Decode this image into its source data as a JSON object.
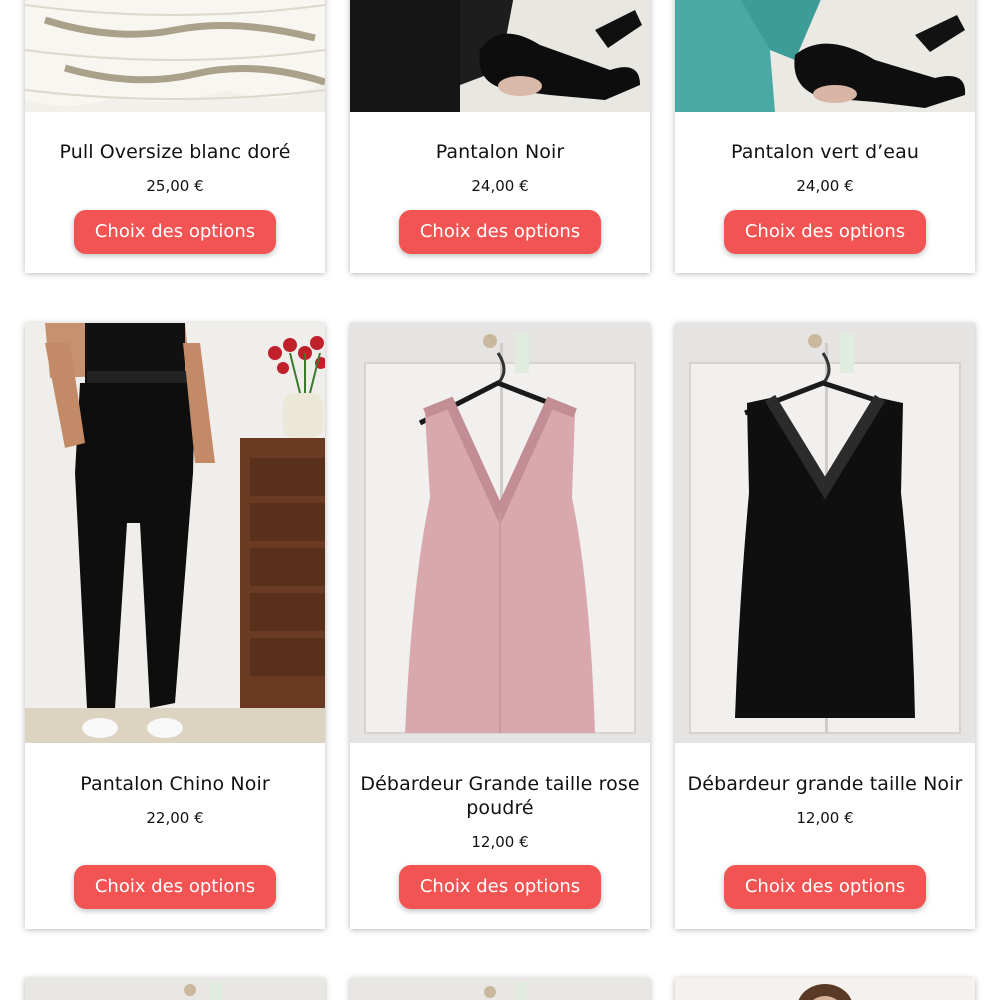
{
  "products": [
    {
      "name": "Pull Oversize blanc doré",
      "price": "25,00 €",
      "button_label": "Choix des options",
      "image": "white-gold-knit-sweater"
    },
    {
      "name": "Pantalon Noir",
      "price": "24,00 €",
      "button_label": "Choix des options",
      "image": "black-trousers-with-heels"
    },
    {
      "name": "Pantalon vert d’eau",
      "price": "24,00 €",
      "button_label": "Choix des options",
      "image": "aqua-green-trousers-with-heels"
    },
    {
      "name": "Pantalon Chino Noir",
      "price": "22,00 €",
      "button_label": "Choix des options",
      "image": "model-wearing-black-chinos"
    },
    {
      "name": "Débardeur Grande taille rose poudré",
      "price": "12,00 €",
      "button_label": "Choix des options",
      "image": "powder-pink-lace-tank-top-on-hanger"
    },
    {
      "name": "Débardeur grande taille Noir",
      "price": "12,00 €",
      "button_label": "Choix des options",
      "image": "black-velvet-lace-tank-top-on-hanger"
    }
  ],
  "colors": {
    "button": "#f25454",
    "button_text": "#ffffff",
    "text": "#111111"
  }
}
